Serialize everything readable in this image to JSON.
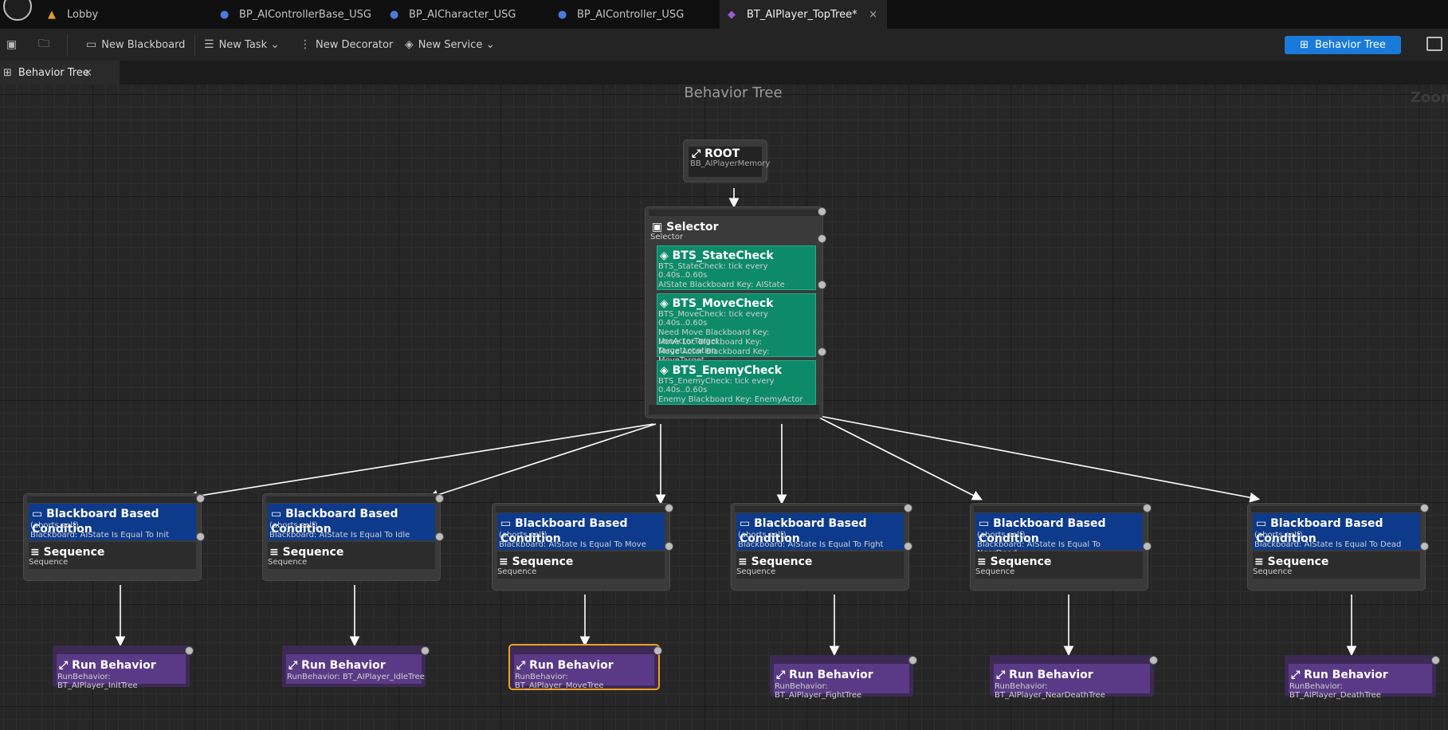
{
  "tabs": [
    {
      "label": "Lobby",
      "icon": "map-icon"
    },
    {
      "label": "BP_AIControllerBase_USG",
      "icon": "controller-icon"
    },
    {
      "label": "BP_AICharacter_USG",
      "icon": "character-icon"
    },
    {
      "label": "BP_AIController_USG",
      "icon": "controller-icon"
    },
    {
      "label": "BT_AIPlayer_TopTree*",
      "icon": "behavior-tree-icon",
      "close": "×"
    }
  ],
  "toolbar": {
    "new_blackboard": "New Blackboard",
    "new_task": "New Task",
    "new_decorator": "New Decorator",
    "new_service": "New Service",
    "mode": "Behavior Tree"
  },
  "doc_tab": {
    "label": "Behavior Tree",
    "close": "×"
  },
  "graph": {
    "title": "Behavior Tree",
    "zoom": "Zoom"
  },
  "root": {
    "title": "ROOT",
    "subtitle": "BB_AIPlayerMemory"
  },
  "selector": {
    "title": "Selector",
    "subtitle": "Selector",
    "services": [
      {
        "title": "BTS_StateCheck",
        "line1": "BTS_StateCheck: tick every 0.40s..0.60s",
        "details": [
          "AIState Blackboard Key: AIState"
        ]
      },
      {
        "title": "BTS_MoveCheck",
        "line1": "BTS_MoveCheck: tick every 0.40s..0.60s",
        "details": [
          "Need Move Blackboard Key: UseActorTarget",
          "Move Loc Blackboard Key: TargetLocation",
          "Move Actor Blackboard Key: MoveTarget"
        ]
      },
      {
        "title": "BTS_EnemyCheck",
        "line1": "BTS_EnemyCheck: tick every 0.40s..0.60s",
        "details": [
          "Enemy Blackboard Key: EnemyActor"
        ]
      }
    ]
  },
  "branches": [
    {
      "decorator": "Blackboard Based Condition",
      "aborts": "(aborts self)",
      "condition": "Blackboard: AIState Is Equal To Init",
      "composite": "Sequence",
      "composite_sub": "Sequence",
      "run_title": "Run Behavior",
      "run_sub": "RunBehavior: BT_AIPlayer_InitTree"
    },
    {
      "decorator": "Blackboard Based Condition",
      "aborts": "(aborts self)",
      "condition": "Blackboard: AIState Is Equal To Idle",
      "composite": "Sequence",
      "composite_sub": "Sequence",
      "run_title": "Run Behavior",
      "run_sub": "RunBehavior: BT_AIPlayer_IdleTree"
    },
    {
      "decorator": "Blackboard Based Condition",
      "aborts": "(aborts self)",
      "condition": "Blackboard: AIState Is Equal To Move",
      "composite": "Sequence",
      "composite_sub": "Sequence",
      "run_title": "Run Behavior",
      "run_sub": "RunBehavior: BT_AIPlayer_MoveTree"
    },
    {
      "decorator": "Blackboard Based Condition",
      "aborts": "(aborts self)",
      "condition": "Blackboard: AIState Is Equal To Fight",
      "composite": "Sequence",
      "composite_sub": "Sequence",
      "run_title": "Run Behavior",
      "run_sub": "RunBehavior: BT_AIPlayer_FightTree"
    },
    {
      "decorator": "Blackboard Based Condition",
      "aborts": "(aborts self)",
      "condition": "Blackboard: AIState Is Equal To NearDead",
      "composite": "Sequence",
      "composite_sub": "Sequence",
      "run_title": "Run Behavior",
      "run_sub": "RunBehavior: BT_AIPlayer_NearDeathTree"
    },
    {
      "decorator": "Blackboard Based Condition",
      "aborts": "(aborts self)",
      "condition": "Blackboard: AIState Is Equal To Dead",
      "composite": "Sequence",
      "composite_sub": "Sequence",
      "run_title": "Run Behavior",
      "run_sub": "RunBehavior: BT_AIPlayer_DeathTree"
    }
  ],
  "colors": {
    "accent": "#1a7ad9",
    "service": "#0d8a6a",
    "decorator": "#0d3a8a",
    "task": "#5a3a86",
    "selected": "#f0a020"
  }
}
